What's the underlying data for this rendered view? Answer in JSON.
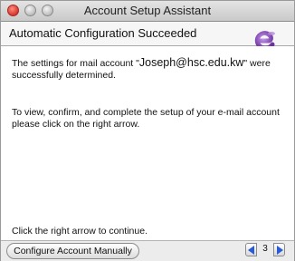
{
  "window": {
    "title": "Account Setup Assistant"
  },
  "header": {
    "title": "Automatic Configuration Succeeded"
  },
  "logo": {
    "icon": "entourage-logo-icon",
    "color": "#8b4bbf"
  },
  "content": {
    "para1_prefix": "The settings for mail account \"",
    "account": "Joseph@hsc.edu.kw",
    "para1_suffix": "\" were successfully determined.",
    "para2": "To view, confirm, and complete the setup of your e-mail account please click on the right arrow.",
    "hint": "Click the right arrow to continue."
  },
  "footer": {
    "manual_button": "Configure Account Manually",
    "page_number": "3",
    "prev_icon": "arrow-left-icon",
    "next_icon": "arrow-right-icon",
    "arrow_color": "#2a5bd7"
  }
}
